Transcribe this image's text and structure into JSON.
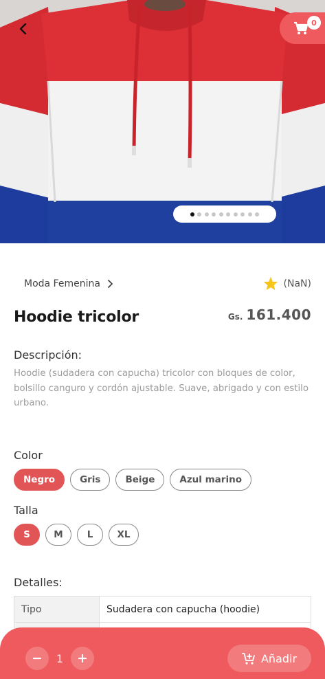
{
  "header": {
    "back_icon": "chevron-left-icon",
    "cart_icon": "cart-icon",
    "cart_count": "0"
  },
  "gallery": {
    "total_images": 10,
    "active_index": 0
  },
  "product": {
    "category": "Moda Femenina",
    "rating_text": "(NaN)",
    "name": "Hoodie tricolor",
    "currency": "Gs.",
    "price": "161.400",
    "description_label": "Descripción:",
    "description": "Hoodie (sudadera con capucha) tricolor con bloques de color, bolsillo canguro y cordón ajustable. Suave, abrigado y con estilo urbano."
  },
  "color": {
    "label": "Color",
    "options": [
      "Negro",
      "Gris",
      "Beige",
      "Azul marino"
    ],
    "selected": "Negro"
  },
  "size": {
    "label": "Talla",
    "options": [
      "S",
      "M",
      "L",
      "XL"
    ],
    "selected": "S"
  },
  "details": {
    "label": "Detalles:",
    "rows": [
      {
        "key": "Tipo",
        "value": "Sudadera con capucha (hoodie)"
      }
    ]
  },
  "footer": {
    "quantity": "1",
    "add_label": "Añadir"
  },
  "colors": {
    "accent": "#ee5a5d",
    "accent_light": "#f27b7d",
    "chip_active": "#e15557",
    "star": "#f5c518"
  }
}
